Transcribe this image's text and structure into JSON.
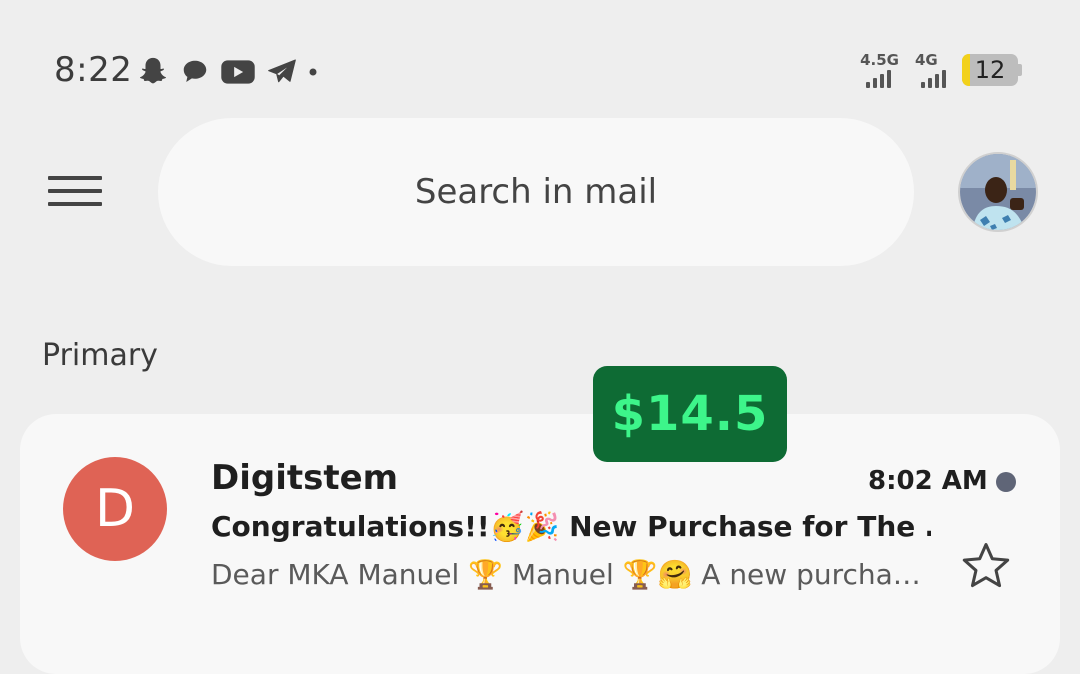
{
  "status_bar": {
    "time": "8:22",
    "notifications": [
      "snapchat-icon",
      "chat-bubble-icon",
      "youtube-icon",
      "telegram-icon",
      "more-dot-icon"
    ],
    "network_1": "4.5G",
    "network_2": "4G",
    "battery_level": "12",
    "battery_fraction": 0.12
  },
  "search": {
    "placeholder": "Search in mail"
  },
  "section": {
    "label": "Primary"
  },
  "email": {
    "avatar_letter": "D",
    "sender": "Digitstem",
    "time": "8:02 AM",
    "subject": "Congratulations!!🥳🎉 New Purchase for The …",
    "preview": "Dear MKA Manuel 🏆 Manuel 🏆🤗 A new purcha…"
  },
  "overlay": {
    "price": "$14.5"
  },
  "colors": {
    "background": "#eeeeee",
    "card": "#f8f8f8",
    "avatar": "#df6355",
    "unread_dot": "#5f6577",
    "badge_bg": "#0e6b34",
    "badge_text": "#3df58a",
    "battery_fill": "#f2d11b"
  }
}
